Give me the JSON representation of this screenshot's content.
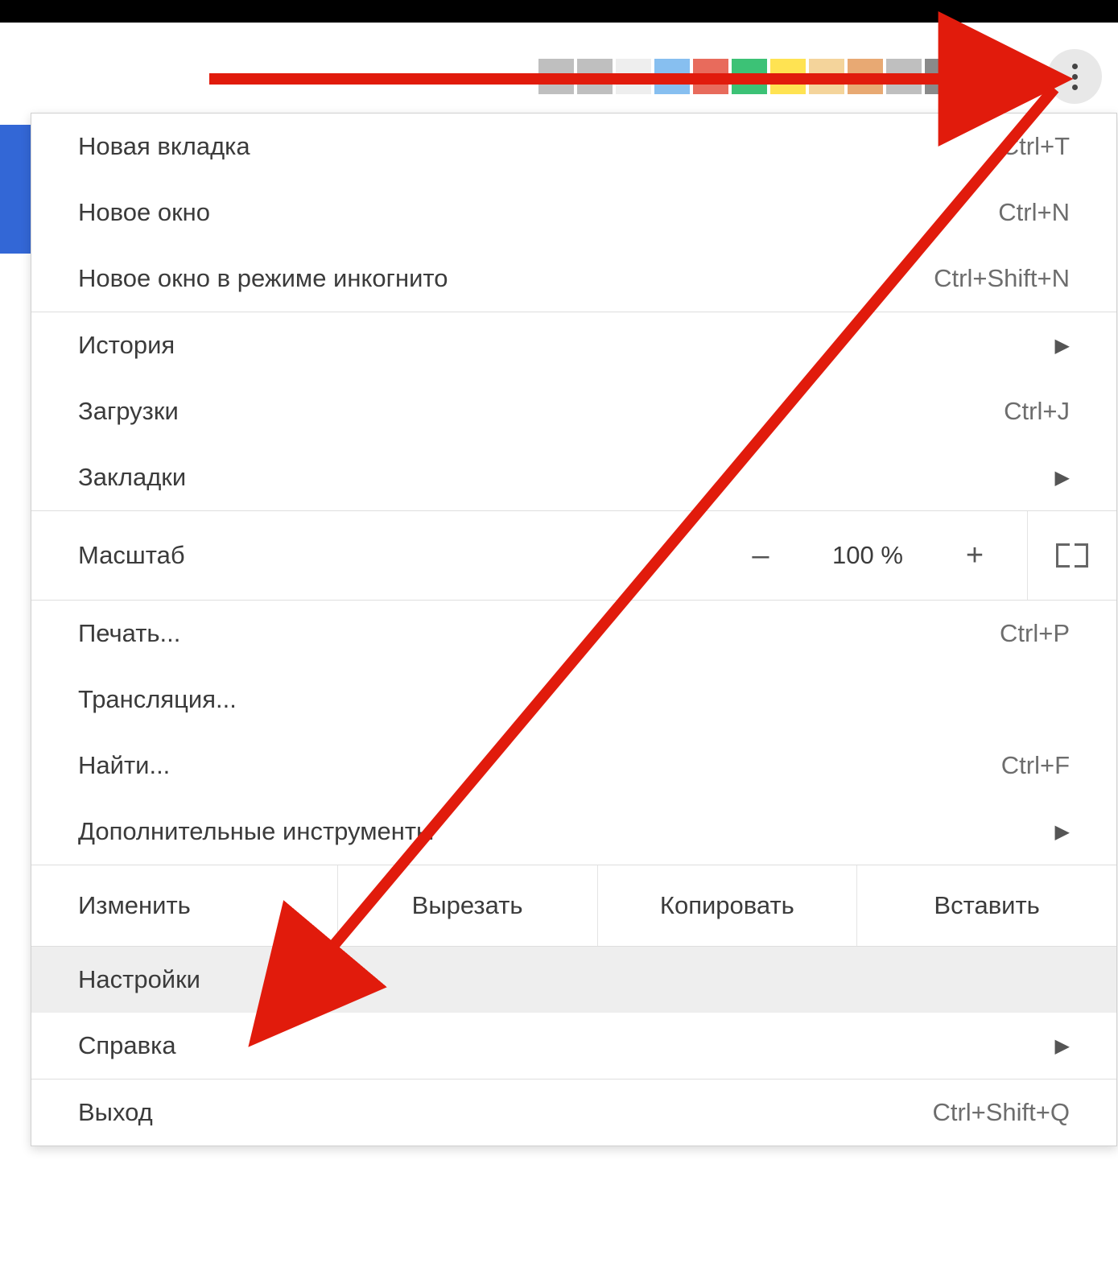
{
  "toolbar_swatches": [
    "#bfbfbf",
    "#bfbfbf",
    "#eeeeee",
    "#87bff0",
    "#e86b5c",
    "#3cc276",
    "#ffe352",
    "#f4d49b",
    "#e8a973",
    "#bfbfbf",
    "#8a8a8a",
    "#7a7a7a"
  ],
  "menu": {
    "new_tab": {
      "label": "Новая вкладка",
      "shortcut": "Ctrl+T"
    },
    "new_window": {
      "label": "Новое окно",
      "shortcut": "Ctrl+N"
    },
    "incognito": {
      "label": "Новое окно в режиме инкогнито",
      "shortcut": "Ctrl+Shift+N"
    },
    "history": {
      "label": "История"
    },
    "downloads": {
      "label": "Загрузки",
      "shortcut": "Ctrl+J"
    },
    "bookmarks": {
      "label": "Закладки"
    },
    "zoom": {
      "label": "Масштаб",
      "value": "100 %",
      "minus": "–",
      "plus": "+"
    },
    "print": {
      "label": "Печать...",
      "shortcut": "Ctrl+P"
    },
    "cast": {
      "label": "Трансляция..."
    },
    "find": {
      "label": "Найти...",
      "shortcut": "Ctrl+F"
    },
    "more_tools": {
      "label": "Дополнительные инструменты"
    },
    "edit": {
      "label": "Изменить",
      "cut": "Вырезать",
      "copy": "Копировать",
      "paste": "Вставить"
    },
    "settings": {
      "label": "Настройки"
    },
    "help": {
      "label": "Справка"
    },
    "exit": {
      "label": "Выход",
      "shortcut": "Ctrl+Shift+Q"
    }
  },
  "annotation": {
    "color": "#e11b0c"
  }
}
